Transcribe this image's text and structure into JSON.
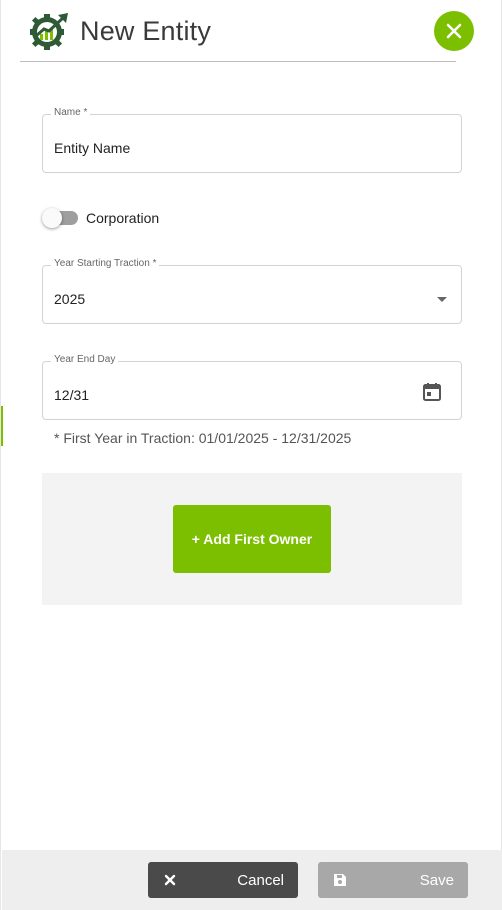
{
  "header": {
    "title": "New Entity",
    "logo_icon": "gear-chart-logo-icon",
    "close_icon": "close-icon"
  },
  "form": {
    "name": {
      "label": "Name *",
      "value": "Entity Name"
    },
    "corporation": {
      "label": "Corporation",
      "checked": false
    },
    "year_starting": {
      "label": "Year Starting Traction *",
      "value": "2025"
    },
    "year_end_day": {
      "label": "Year End Day",
      "value": "12/31",
      "icon": "calendar-icon"
    },
    "hint": "* First Year in Traction: 01/01/2025 - 12/31/2025"
  },
  "owners": {
    "add_button": "+ Add First Owner"
  },
  "footer": {
    "cancel_label": "Cancel",
    "cancel_icon": "x-icon",
    "save_label": "Save",
    "save_icon": "floppy-disk-icon"
  },
  "colors": {
    "accent": "#7cbf00",
    "logo_dark": "#2e5a36",
    "cancel_bg": "#4a4a4a",
    "save_bg": "#a8a8a8"
  }
}
